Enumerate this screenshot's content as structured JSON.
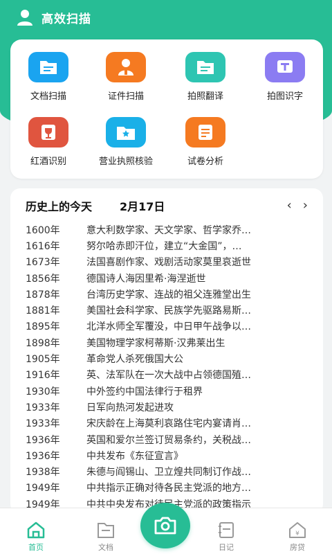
{
  "app": {
    "title": "高效扫描"
  },
  "colors": {
    "brand": "#27bd95",
    "blue": "#1aa4f0",
    "orange": "#f57a21",
    "teal": "#2ec5b2",
    "purple": "#8b7cf2",
    "red": "#e0553f"
  },
  "tools": [
    {
      "label": "文档扫描",
      "icon": "document-icon"
    },
    {
      "label": "证件扫描",
      "icon": "id-person-icon"
    },
    {
      "label": "拍照翻译",
      "icon": "translate-doc-icon"
    },
    {
      "label": "拍图识字",
      "icon": "text-recognition-icon"
    },
    {
      "label": "红酒识别",
      "icon": "wine-icon"
    },
    {
      "label": "营业执照核验",
      "icon": "license-icon"
    },
    {
      "label": "试卷分析",
      "icon": "exam-icon"
    }
  ],
  "history": {
    "title": "历史上的今天",
    "date": "2月17日",
    "prev": "‹",
    "next": "›",
    "events": [
      {
        "year": "1600年",
        "text": "意大利数学家、天文学家、哲学家乔…"
      },
      {
        "year": "1616年",
        "text": "努尔哈赤即汗位，建立“大金国”，…"
      },
      {
        "year": "1673年",
        "text": "法国喜剧作家、戏剧活动家莫里哀逝世"
      },
      {
        "year": "1856年",
        "text": "德国诗人海因里希·海涅逝世"
      },
      {
        "year": "1878年",
        "text": "台湾历史学家、连战的祖父连雅堂出生"
      },
      {
        "year": "1881年",
        "text": "美国社会科学家、民族学先驱路易斯…"
      },
      {
        "year": "1895年",
        "text": "北洋水师全军覆没，中日甲午战争以…"
      },
      {
        "year": "1898年",
        "text": "美国物理学家柯蒂斯·汉弗莱出生"
      },
      {
        "year": "1905年",
        "text": "革命党人杀死俄国大公"
      },
      {
        "year": "1916年",
        "text": "英、法军队在一次大战中占领德国殖…"
      },
      {
        "year": "1930年",
        "text": "中外签约中国法律行于租界"
      },
      {
        "year": "1933年",
        "text": "日军向热河发起进攻"
      },
      {
        "year": "1933年",
        "text": "宋庆龄在上海莫利哀路住宅内宴请肖…"
      },
      {
        "year": "1936年",
        "text": "英国和爱尔兰签订贸易条约，关税战…"
      },
      {
        "year": "1936年",
        "text": "中共发布《东征宣言》"
      },
      {
        "year": "1938年",
        "text": "朱德与阎锡山、卫立煌共同制订作战…"
      },
      {
        "year": "1949年",
        "text": "中共指示正确对待各民主党派的地方…"
      },
      {
        "year": "1949年",
        "text": "中共中央发布对待民主党派的政策指示"
      }
    ]
  },
  "nav": {
    "home": "首页",
    "docs": "文档",
    "diary": "日记",
    "loan": "房贷"
  }
}
